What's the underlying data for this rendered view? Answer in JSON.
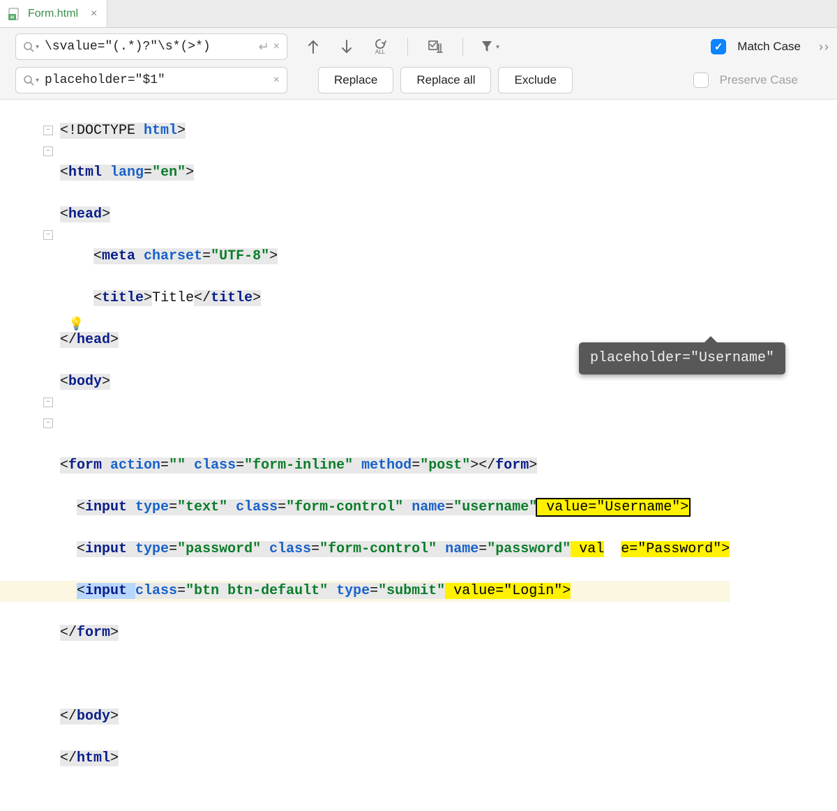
{
  "tab": {
    "label": "Form.html"
  },
  "search": {
    "find_value": "\\svalue=\"(.*)?\"\\s*(>*)",
    "replace_value": "placeholder=\"$1\""
  },
  "buttons": {
    "replace": "Replace",
    "replace_all": "Replace all",
    "exclude": "Exclude"
  },
  "options": {
    "match_case": "Match Case",
    "preserve_case": "Preserve Case"
  },
  "tooltip": "placeholder=\"Username\"",
  "code": {
    "doctype": "<!DOCTYPE ",
    "doctype_kw": "html",
    "html_open": "<html ",
    "lang_attr": "lang",
    "lang_val": "\"en\"",
    "head_open": "<head>",
    "meta_open": "<meta ",
    "charset_attr": "charset",
    "charset_val": "\"UTF-8\"",
    "title_open": "<title>",
    "title_text": "Title",
    "title_close": "</title>",
    "head_close": "</head>",
    "body_open": "<body>",
    "form_open": "<form ",
    "action_attr": "action",
    "empty_str": "\"\"",
    "class_attr": "class",
    "form_inline": "\"form-inline\"",
    "method_attr": "method",
    "post": "\"post\"",
    "form_close_tag": "></form>",
    "input_open": "<input ",
    "type_attr": "type",
    "text_val": "\"text\"",
    "form_control": "\"form-control\"",
    "name_attr": "name",
    "username": "\"username\"",
    "value_username": " value=\"Username\">",
    "password_val": "\"password\"",
    "password_name": "\"password\"",
    "value_password_a": " val",
    "value_password_b": "e=\"Password\">",
    "btn_class": "\"btn btn-default\"",
    "submit": "\"submit\"",
    "value_login": " value=\"Login\">",
    "form_close": "</form>",
    "body_close": "</body>",
    "html_close": "</html>"
  }
}
